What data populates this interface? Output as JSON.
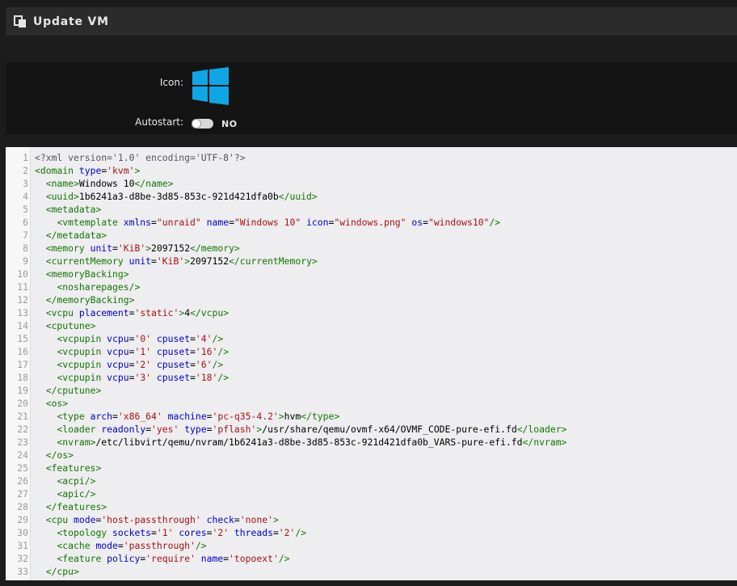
{
  "title": "Update VM",
  "title_icon": "clipboard-copy-icon",
  "settings": {
    "icon_label": "Icon:",
    "icon_name": "windows-logo-icon",
    "icon_color": "#0fa6e6",
    "autostart_label": "Autostart:",
    "autostart_state": "NO",
    "autostart_on": false
  },
  "colors": {
    "tag": "#117700",
    "attribute": "#0000cc",
    "string": "#aa1111",
    "text": "#000000"
  },
  "editor": {
    "lines": [
      [
        [
          "meta",
          "<?xml version='1.0' encoding='UTF-8'?>"
        ]
      ],
      [
        [
          "tag",
          "<domain "
        ],
        [
          "attr",
          "type"
        ],
        [
          "plain",
          "="
        ],
        [
          "str",
          "'kvm'"
        ],
        [
          "tag",
          ">"
        ]
      ],
      [
        [
          "plain",
          "  "
        ],
        [
          "tag",
          "<name>"
        ],
        [
          "plain",
          "Windows 10"
        ],
        [
          "tag",
          "</name>"
        ]
      ],
      [
        [
          "plain",
          "  "
        ],
        [
          "tag",
          "<uuid>"
        ],
        [
          "plain",
          "1b6241a3-d8be-3d85-853c-921d421dfa0b"
        ],
        [
          "tag",
          "</uuid>"
        ]
      ],
      [
        [
          "plain",
          "  "
        ],
        [
          "tag",
          "<metadata>"
        ]
      ],
      [
        [
          "plain",
          "    "
        ],
        [
          "tag",
          "<vmtemplate "
        ],
        [
          "attr",
          "xmlns"
        ],
        [
          "plain",
          "="
        ],
        [
          "str",
          "\"unraid\""
        ],
        [
          "plain",
          " "
        ],
        [
          "attr",
          "name"
        ],
        [
          "plain",
          "="
        ],
        [
          "str",
          "\"Windows 10\""
        ],
        [
          "plain",
          " "
        ],
        [
          "attr",
          "icon"
        ],
        [
          "plain",
          "="
        ],
        [
          "str",
          "\"windows.png\""
        ],
        [
          "plain",
          " "
        ],
        [
          "attr",
          "os"
        ],
        [
          "plain",
          "="
        ],
        [
          "str",
          "\"windows10\""
        ],
        [
          "tag",
          "/>"
        ]
      ],
      [
        [
          "plain",
          "  "
        ],
        [
          "tag",
          "</metadata>"
        ]
      ],
      [
        [
          "plain",
          "  "
        ],
        [
          "tag",
          "<memory "
        ],
        [
          "attr",
          "unit"
        ],
        [
          "plain",
          "="
        ],
        [
          "str",
          "'KiB'"
        ],
        [
          "tag",
          ">"
        ],
        [
          "plain",
          "2097152"
        ],
        [
          "tag",
          "</memory>"
        ]
      ],
      [
        [
          "plain",
          "  "
        ],
        [
          "tag",
          "<currentMemory "
        ],
        [
          "attr",
          "unit"
        ],
        [
          "plain",
          "="
        ],
        [
          "str",
          "'KiB'"
        ],
        [
          "tag",
          ">"
        ],
        [
          "plain",
          "2097152"
        ],
        [
          "tag",
          "</currentMemory>"
        ]
      ],
      [
        [
          "plain",
          "  "
        ],
        [
          "tag",
          "<memoryBacking>"
        ]
      ],
      [
        [
          "plain",
          "    "
        ],
        [
          "tag",
          "<nosharepages/>"
        ]
      ],
      [
        [
          "plain",
          "  "
        ],
        [
          "tag",
          "</memoryBacking>"
        ]
      ],
      [
        [
          "plain",
          "  "
        ],
        [
          "tag",
          "<vcpu "
        ],
        [
          "attr",
          "placement"
        ],
        [
          "plain",
          "="
        ],
        [
          "str",
          "'static'"
        ],
        [
          "tag",
          ">"
        ],
        [
          "plain",
          "4"
        ],
        [
          "tag",
          "</vcpu>"
        ]
      ],
      [
        [
          "plain",
          "  "
        ],
        [
          "tag",
          "<cputune>"
        ]
      ],
      [
        [
          "plain",
          "    "
        ],
        [
          "tag",
          "<vcpupin "
        ],
        [
          "attr",
          "vcpu"
        ],
        [
          "plain",
          "="
        ],
        [
          "str",
          "'0'"
        ],
        [
          "plain",
          " "
        ],
        [
          "attr",
          "cpuset"
        ],
        [
          "plain",
          "="
        ],
        [
          "str",
          "'4'"
        ],
        [
          "tag",
          "/>"
        ]
      ],
      [
        [
          "plain",
          "    "
        ],
        [
          "tag",
          "<vcpupin "
        ],
        [
          "attr",
          "vcpu"
        ],
        [
          "plain",
          "="
        ],
        [
          "str",
          "'1'"
        ],
        [
          "plain",
          " "
        ],
        [
          "attr",
          "cpuset"
        ],
        [
          "plain",
          "="
        ],
        [
          "str",
          "'16'"
        ],
        [
          "tag",
          "/>"
        ]
      ],
      [
        [
          "plain",
          "    "
        ],
        [
          "tag",
          "<vcpupin "
        ],
        [
          "attr",
          "vcpu"
        ],
        [
          "plain",
          "="
        ],
        [
          "str",
          "'2'"
        ],
        [
          "plain",
          " "
        ],
        [
          "attr",
          "cpuset"
        ],
        [
          "plain",
          "="
        ],
        [
          "str",
          "'6'"
        ],
        [
          "tag",
          "/>"
        ]
      ],
      [
        [
          "plain",
          "    "
        ],
        [
          "tag",
          "<vcpupin "
        ],
        [
          "attr",
          "vcpu"
        ],
        [
          "plain",
          "="
        ],
        [
          "str",
          "'3'"
        ],
        [
          "plain",
          " "
        ],
        [
          "attr",
          "cpuset"
        ],
        [
          "plain",
          "="
        ],
        [
          "str",
          "'18'"
        ],
        [
          "tag",
          "/>"
        ]
      ],
      [
        [
          "plain",
          "  "
        ],
        [
          "tag",
          "</cputune>"
        ]
      ],
      [
        [
          "plain",
          "  "
        ],
        [
          "tag",
          "<os>"
        ]
      ],
      [
        [
          "plain",
          "    "
        ],
        [
          "tag",
          "<type "
        ],
        [
          "attr",
          "arch"
        ],
        [
          "plain",
          "="
        ],
        [
          "str",
          "'x86_64'"
        ],
        [
          "plain",
          " "
        ],
        [
          "attr",
          "machine"
        ],
        [
          "plain",
          "="
        ],
        [
          "str",
          "'pc-q35-4.2'"
        ],
        [
          "tag",
          ">"
        ],
        [
          "plain",
          "hvm"
        ],
        [
          "tag",
          "</type>"
        ]
      ],
      [
        [
          "plain",
          "    "
        ],
        [
          "tag",
          "<loader "
        ],
        [
          "attr",
          "readonly"
        ],
        [
          "plain",
          "="
        ],
        [
          "str",
          "'yes'"
        ],
        [
          "plain",
          " "
        ],
        [
          "attr",
          "type"
        ],
        [
          "plain",
          "="
        ],
        [
          "str",
          "'pflash'"
        ],
        [
          "tag",
          ">"
        ],
        [
          "plain",
          "/usr/share/qemu/ovmf-x64/OVMF_CODE-pure-efi.fd"
        ],
        [
          "tag",
          "</loader>"
        ]
      ],
      [
        [
          "plain",
          "    "
        ],
        [
          "tag",
          "<nvram>"
        ],
        [
          "plain",
          "/etc/libvirt/qemu/nvram/1b6241a3-d8be-3d85-853c-921d421dfa0b_VARS-pure-efi.fd"
        ],
        [
          "tag",
          "</nvram>"
        ]
      ],
      [
        [
          "plain",
          "  "
        ],
        [
          "tag",
          "</os>"
        ]
      ],
      [
        [
          "plain",
          "  "
        ],
        [
          "tag",
          "<features>"
        ]
      ],
      [
        [
          "plain",
          "    "
        ],
        [
          "tag",
          "<acpi/>"
        ]
      ],
      [
        [
          "plain",
          "    "
        ],
        [
          "tag",
          "<apic/>"
        ]
      ],
      [
        [
          "plain",
          "  "
        ],
        [
          "tag",
          "</features>"
        ]
      ],
      [
        [
          "plain",
          "  "
        ],
        [
          "tag",
          "<cpu "
        ],
        [
          "attr",
          "mode"
        ],
        [
          "plain",
          "="
        ],
        [
          "str",
          "'host-passthrough'"
        ],
        [
          "plain",
          " "
        ],
        [
          "attr",
          "check"
        ],
        [
          "plain",
          "="
        ],
        [
          "str",
          "'none'"
        ],
        [
          "tag",
          ">"
        ]
      ],
      [
        [
          "plain",
          "    "
        ],
        [
          "tag",
          "<topology "
        ],
        [
          "attr",
          "sockets"
        ],
        [
          "plain",
          "="
        ],
        [
          "str",
          "'1'"
        ],
        [
          "plain",
          " "
        ],
        [
          "attr",
          "cores"
        ],
        [
          "plain",
          "="
        ],
        [
          "str",
          "'2'"
        ],
        [
          "plain",
          " "
        ],
        [
          "attr",
          "threads"
        ],
        [
          "plain",
          "="
        ],
        [
          "str",
          "'2'"
        ],
        [
          "tag",
          "/>"
        ]
      ],
      [
        [
          "plain",
          "    "
        ],
        [
          "tag",
          "<cache "
        ],
        [
          "attr",
          "mode"
        ],
        [
          "plain",
          "="
        ],
        [
          "str",
          "'passthrough'"
        ],
        [
          "tag",
          "/>"
        ]
      ],
      [
        [
          "plain",
          "    "
        ],
        [
          "tag",
          "<feature "
        ],
        [
          "attr",
          "policy"
        ],
        [
          "plain",
          "="
        ],
        [
          "str",
          "'require'"
        ],
        [
          "plain",
          " "
        ],
        [
          "attr",
          "name"
        ],
        [
          "plain",
          "="
        ],
        [
          "str",
          "'topoext'"
        ],
        [
          "tag",
          "/>"
        ]
      ],
      [
        [
          "plain",
          "  "
        ],
        [
          "tag",
          "</cpu>"
        ]
      ]
    ]
  }
}
